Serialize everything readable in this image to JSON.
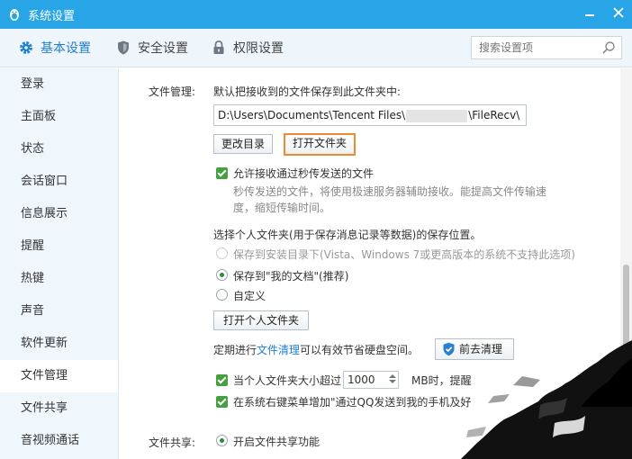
{
  "window": {
    "title": "系统设置"
  },
  "tabs": [
    {
      "label": "基本设置",
      "icon": "gear-icon"
    },
    {
      "label": "安全设置",
      "icon": "shield-icon"
    },
    {
      "label": "权限设置",
      "icon": "lock-icon"
    }
  ],
  "search": {
    "placeholder": "搜索设置项"
  },
  "sidebar": {
    "items": [
      "登录",
      "主面板",
      "状态",
      "会话窗口",
      "信息展示",
      "提醒",
      "热键",
      "声音",
      "软件更新",
      "文件管理",
      "文件共享",
      "音视频通话"
    ],
    "active": "文件管理"
  },
  "file_mgmt": {
    "section_label": "文件管理:",
    "save_desc": "默认把接收到的文件保存到此文件夹中:",
    "path_prefix": "D:\\Users\\Documents\\Tencent Files\\",
    "path_suffix": "\\FileRecv\\",
    "change_dir_btn": "更改目录",
    "open_folder_btn": "打开文件夹",
    "allow_transfer_label": "允许接收通过秒传发送的文件",
    "allow_transfer_hint_1": "秒传发送的文件，将使用极速服务器辅助接收。能提高文件传输速",
    "allow_transfer_hint_2": "度，缩短传输时间。",
    "personal_folder_desc": "选择个人文件夹(用于保存消息记录等数据)的保存位置。",
    "opt_install_dir": "保存到安装目录下(Vista、Windows 7或更高版本的系统不支持此选项)",
    "opt_my_docs": "保存到\"我的文档\"(推荐)",
    "opt_custom": "自定义",
    "open_personal_btn": "打开个人文件夹",
    "cleanup_prefix": "定期进行",
    "cleanup_link": "文件清理",
    "cleanup_suffix": "可以有效节省硬盘空间。",
    "cleanup_btn": "前去清理",
    "size_limit_prefix": "当个人文件夹大小超过",
    "size_limit_value": "1000",
    "size_limit_suffix": "MB时，提醒",
    "context_menu_label": "在系统右键菜单增加\"通过QQ发送到我的手机及好"
  },
  "file_share": {
    "section_label": "文件共享:",
    "enable_label": "开启文件共享功能"
  },
  "colors": {
    "titlebar": "#27a5e6",
    "accent": "#1f7fd0",
    "highlight_border": "#ee8a32",
    "checkbox": "#45a13f"
  }
}
